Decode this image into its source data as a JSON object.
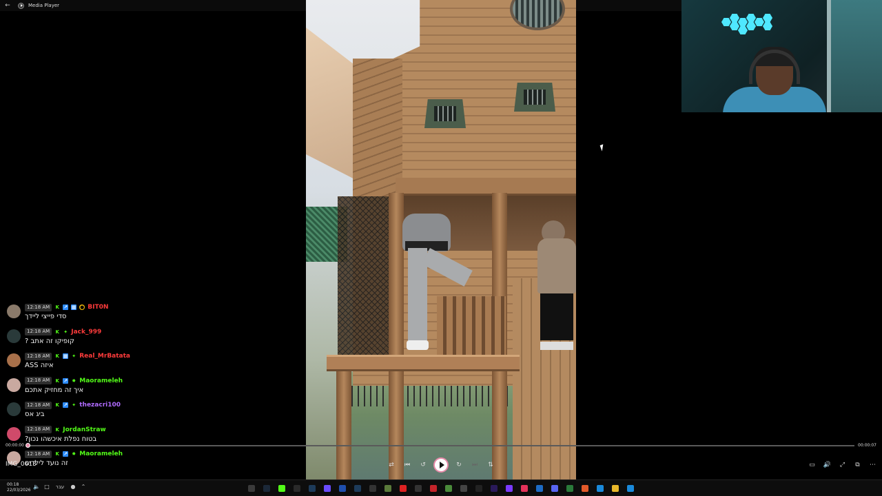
{
  "window": {
    "title": "Media Player",
    "back_icon": "back-arrow-icon"
  },
  "chat": {
    "messages": [
      {
        "time": "12:18 AM",
        "username": "BIT0N",
        "color": "#ff3b3b",
        "badges": [
          "kick-icon",
          "verified-icon",
          "sub-icon",
          "coin-icon"
        ],
        "avatar": "#8a7a6a",
        "text": "סדי פייצי ליידך"
      },
      {
        "time": "12:18 AM",
        "username": "Jack_999",
        "color": "#ff3b3b",
        "badges": [
          "kick-icon",
          "star-icon"
        ],
        "avatar": "#2a3a3a",
        "text": "קופיקו זה אתב ?"
      },
      {
        "time": "12:18 AM",
        "username": "Real_MrBatata",
        "color": "#ff3b3b",
        "badges": [
          "kick-icon",
          "sub-icon",
          "star-icon"
        ],
        "avatar": "#a8704a",
        "text": "איזה ASS"
      },
      {
        "time": "12:18 AM",
        "username": "Maorameleh",
        "color": "#53fc18",
        "badges": [
          "kick-icon",
          "verified-icon",
          "gear-icon"
        ],
        "avatar": "#c9a9a0",
        "text": "איך זה מחזיק אתכם"
      },
      {
        "time": "12:18 AM",
        "username": "thezacri100",
        "color": "#b06bff",
        "badges": [
          "kick-icon",
          "verified-icon",
          "star-icon"
        ],
        "avatar": "#2a3a3a",
        "text": "ביג אס"
      },
      {
        "time": "12:18 AM",
        "username": "JordanStraw",
        "color": "#53fc18",
        "badges": [
          "kick-icon"
        ],
        "avatar": "#d04a6a",
        "text": "בטוח נפלת איכשהו נכון?"
      },
      {
        "time": "12:18 AM",
        "username": "Maorameleh",
        "color": "#53fc18",
        "badges": [
          "kick-icon",
          "verified-icon",
          "gear-icon"
        ],
        "avatar": "#c9a9a0",
        "text": "זה נועד לילדים"
      }
    ]
  },
  "player": {
    "current_time": "00:00:00",
    "duration": "00:00:07",
    "progress": 0.0,
    "filename": "IMG_0613",
    "accent": "#e58aa8",
    "controls": [
      "shuffle-icon",
      "previous-icon",
      "rewind-10-icon",
      "play-icon",
      "forward-30-icon",
      "next-icon",
      "repeat-off-icon"
    ],
    "right_controls": [
      "captions-icon",
      "volume-icon",
      "fullscreen-icon",
      "mini-player-icon",
      "more-options-icon"
    ]
  },
  "taskbar": {
    "time": "00:18",
    "date": "22/03/2026",
    "language": "עבר",
    "tray": [
      "volume-icon",
      "network-icon",
      "microphone-icon",
      "chevron-up-icon"
    ],
    "apps": [
      {
        "name": "media-player-icon",
        "color": "#3a3a3a"
      },
      {
        "name": "steam-icon",
        "color": "#1b2838"
      },
      {
        "name": "kick-icon",
        "color": "#53fc18"
      },
      {
        "name": "epic-icon",
        "color": "#2a2a2a"
      },
      {
        "name": "app-icon",
        "color": "#1d3b5a"
      },
      {
        "name": "grid-app-icon",
        "color": "#6a4cff"
      },
      {
        "name": "bluetooth-icon",
        "color": "#1f4fae"
      },
      {
        "name": "app-icon",
        "color": "#1d3b5a"
      },
      {
        "name": "obs-icon",
        "color": "#333"
      },
      {
        "name": "notepad-icon",
        "color": "#5a7a3a"
      },
      {
        "name": "game-icon",
        "color": "#d22"
      },
      {
        "name": "notes-icon",
        "color": "#333"
      },
      {
        "name": "acrobat-icon",
        "color": "#c4242a"
      },
      {
        "name": "minecraft-icon",
        "color": "#4a8a3a"
      },
      {
        "name": "settings-icon",
        "color": "#444"
      },
      {
        "name": "capcut-icon",
        "color": "#222"
      },
      {
        "name": "premiere-icon",
        "color": "#2a1a5a"
      },
      {
        "name": "app-icon",
        "color": "#7a3aff"
      },
      {
        "name": "music-icon",
        "color": "#e4325a"
      },
      {
        "name": "photos-icon",
        "color": "#1d6bc4"
      },
      {
        "name": "discord-icon",
        "color": "#5865f2"
      },
      {
        "name": "chrome-icon",
        "color": "#2a7a3a"
      },
      {
        "name": "brave-icon",
        "color": "#e35a2a"
      },
      {
        "name": "edge-icon",
        "color": "#1a8adb"
      },
      {
        "name": "explorer-icon",
        "color": "#e8b82a"
      },
      {
        "name": "windows-start-icon",
        "color": "#1a8adb"
      }
    ]
  }
}
